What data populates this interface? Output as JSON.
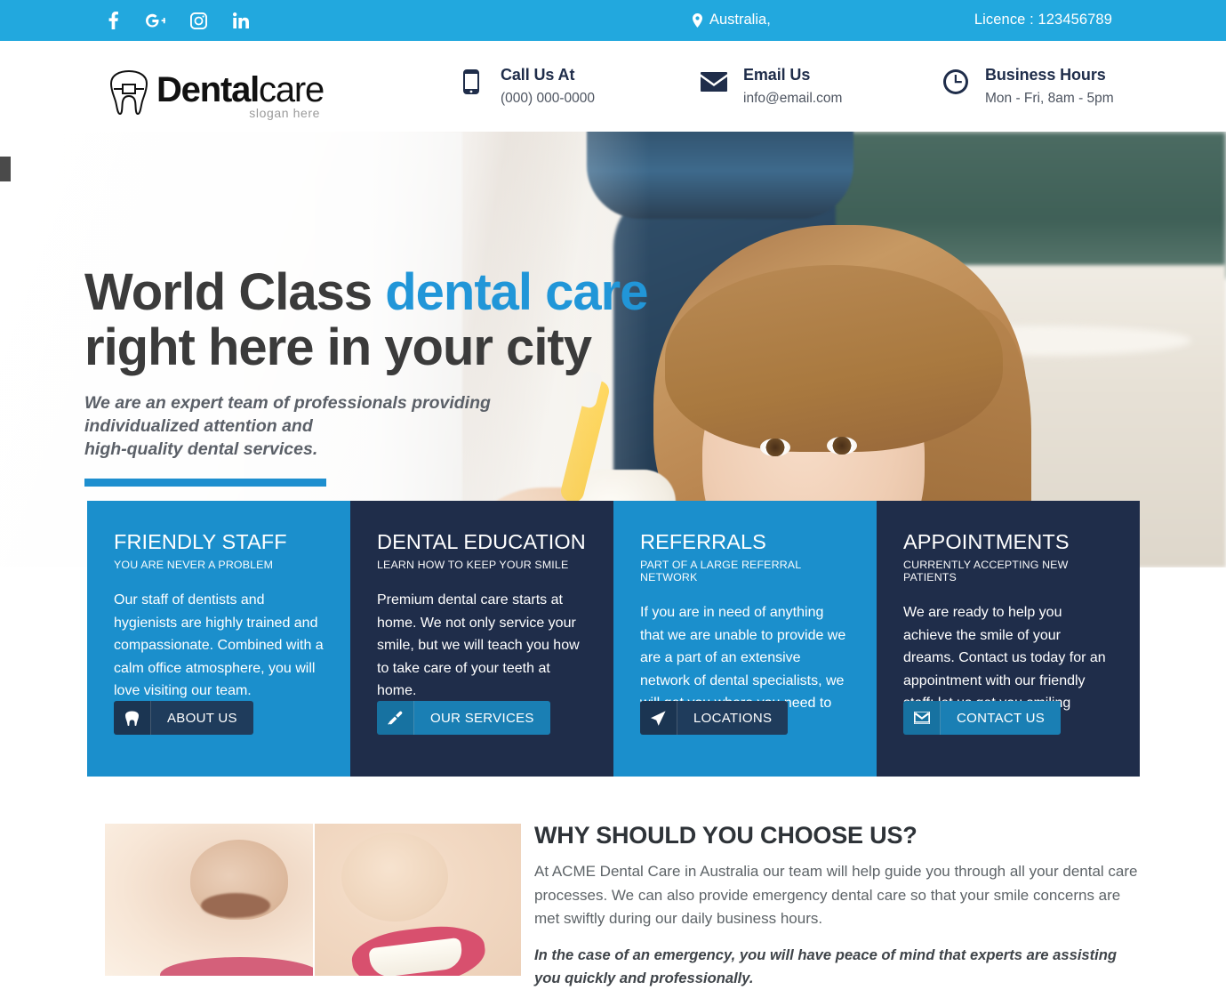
{
  "topbar": {
    "social": [
      {
        "name": "facebook-icon",
        "label": "Facebook"
      },
      {
        "name": "google-plus-icon",
        "label": "Google Plus"
      },
      {
        "name": "instagram-icon",
        "label": "Instagram"
      },
      {
        "name": "linkedin-icon",
        "label": "LinkedIn"
      }
    ],
    "location": "Australia,",
    "licence": "Licence : 123456789"
  },
  "header": {
    "logo": {
      "bold": "Dental",
      "light": "care",
      "slogan": "slogan here"
    },
    "contacts": [
      {
        "icon": "phone-icon",
        "title": "Call Us At",
        "value": "(000) 000-0000"
      },
      {
        "icon": "envelope-icon",
        "title": "Email Us",
        "value": "info@email.com"
      },
      {
        "icon": "clock-icon",
        "title": "Business Hours",
        "value": "Mon - Fri, 8am - 5pm"
      }
    ]
  },
  "hero": {
    "title_part1": "World Class ",
    "title_accent": "dental care",
    "title_line2": "right here in your city",
    "subtitle": "We are an expert team of professionals providing\nindividualized attention and\nhigh-quality dental services."
  },
  "cards": [
    {
      "theme": "blue",
      "title": "FRIENDLY STAFF",
      "subtitle": "YOU ARE NEVER A PROBLEM",
      "body": "Our staff of dentists and hygienists are highly trained and compassionate. Combined with a calm office atmosphere, you will love visiting our team.",
      "button_label": "ABOUT US",
      "button_icon": "tooth-icon"
    },
    {
      "theme": "navy",
      "title": "DENTAL EDUCATION",
      "subtitle": "LEARN HOW TO KEEP YOUR SMILE",
      "body": "Premium dental care starts at home. We not only service your smile, but we will teach you how to take care of your teeth at home.",
      "button_label": "OUR SERVICES",
      "button_icon": "toothbrush-icon"
    },
    {
      "theme": "blue",
      "title": "REFERRALS",
      "subtitle": "PART OF A LARGE REFERRAL NETWORK",
      "body": "If you are in need of anything that we are unable to provide we are a part of an extensive network of dental specialists, we will get you where you need to be.",
      "button_label": "LOCATIONS",
      "button_icon": "navigation-arrow-icon"
    },
    {
      "theme": "navy",
      "title": "APPOINTMENTS",
      "subtitle": "CURRENTLY ACCEPTING NEW PATIENTS",
      "body": "We are ready to help you achieve the smile of your dreams. Contact us today for an appointment with our friendly staff; let us get you smiling again.",
      "button_label": "CONTACT US",
      "button_icon": "envelope-icon"
    }
  ],
  "why": {
    "title": "WHY SHOULD YOU CHOOSE US?",
    "paragraph": "At ACME Dental Care in Australia our team will help guide you through all your dental care processes. We can also provide emergency dental care so that your smile concerns are met swiftly during our daily business hours.",
    "emphasis": "In the case of an emergency, you will have peace of mind that experts are assisting you quickly and professionally."
  },
  "colors": {
    "topbar_blue": "#22a8de",
    "accent_blue": "#1b8fcc",
    "navy": "#1f2d4a",
    "hero_accent": "#2196d8"
  }
}
